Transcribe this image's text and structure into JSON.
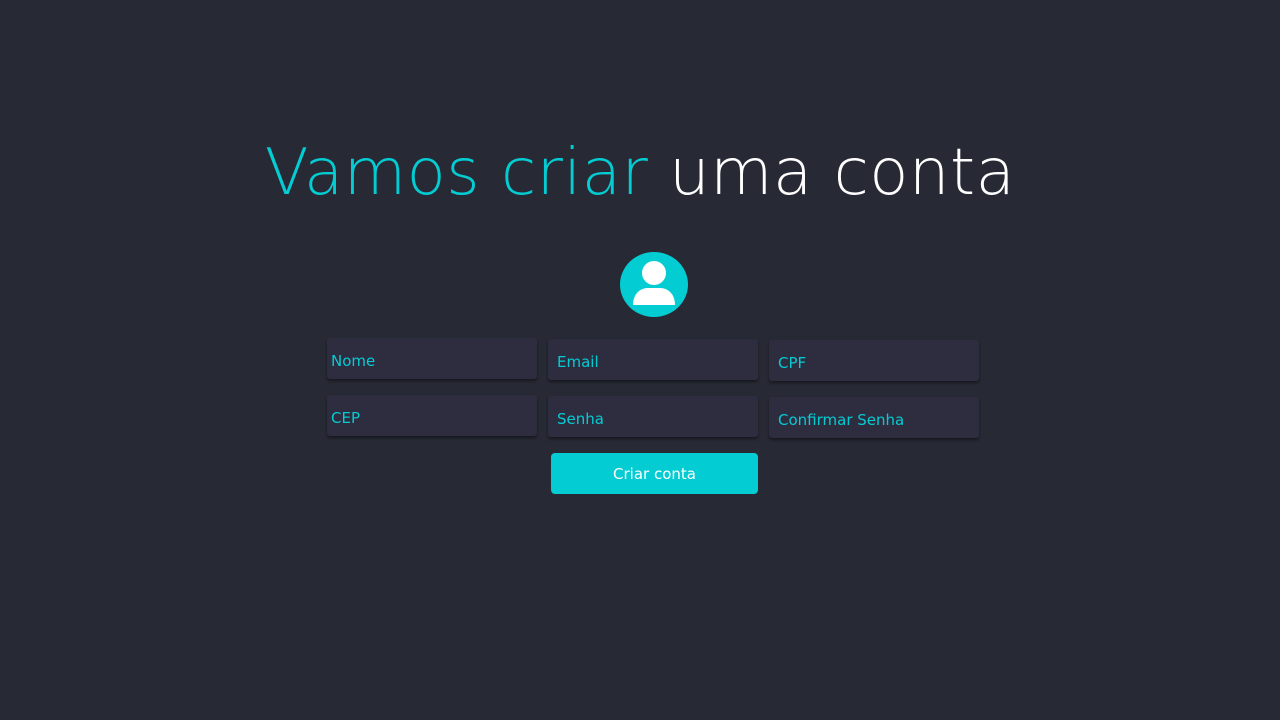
{
  "heading": {
    "accent_text": "Vamos criar",
    "plain_text": "uma conta"
  },
  "avatar": {
    "icon": "user-icon"
  },
  "form": {
    "fields": [
      {
        "name": "nome",
        "placeholder": "Nome",
        "value": ""
      },
      {
        "name": "email",
        "placeholder": "Email",
        "value": ""
      },
      {
        "name": "cpf",
        "placeholder": "CPF",
        "value": ""
      },
      {
        "name": "cep",
        "placeholder": "CEP",
        "value": ""
      },
      {
        "name": "senha",
        "placeholder": "Senha",
        "value": ""
      },
      {
        "name": "confirmar-senha",
        "placeholder": "Confirmar Senha",
        "value": ""
      }
    ],
    "submit_label": "Criar conta"
  },
  "colors": {
    "background": "#272a35",
    "accent": "#04ccd3",
    "field_background": "#2e2d40",
    "text_white": "#ffffff"
  }
}
